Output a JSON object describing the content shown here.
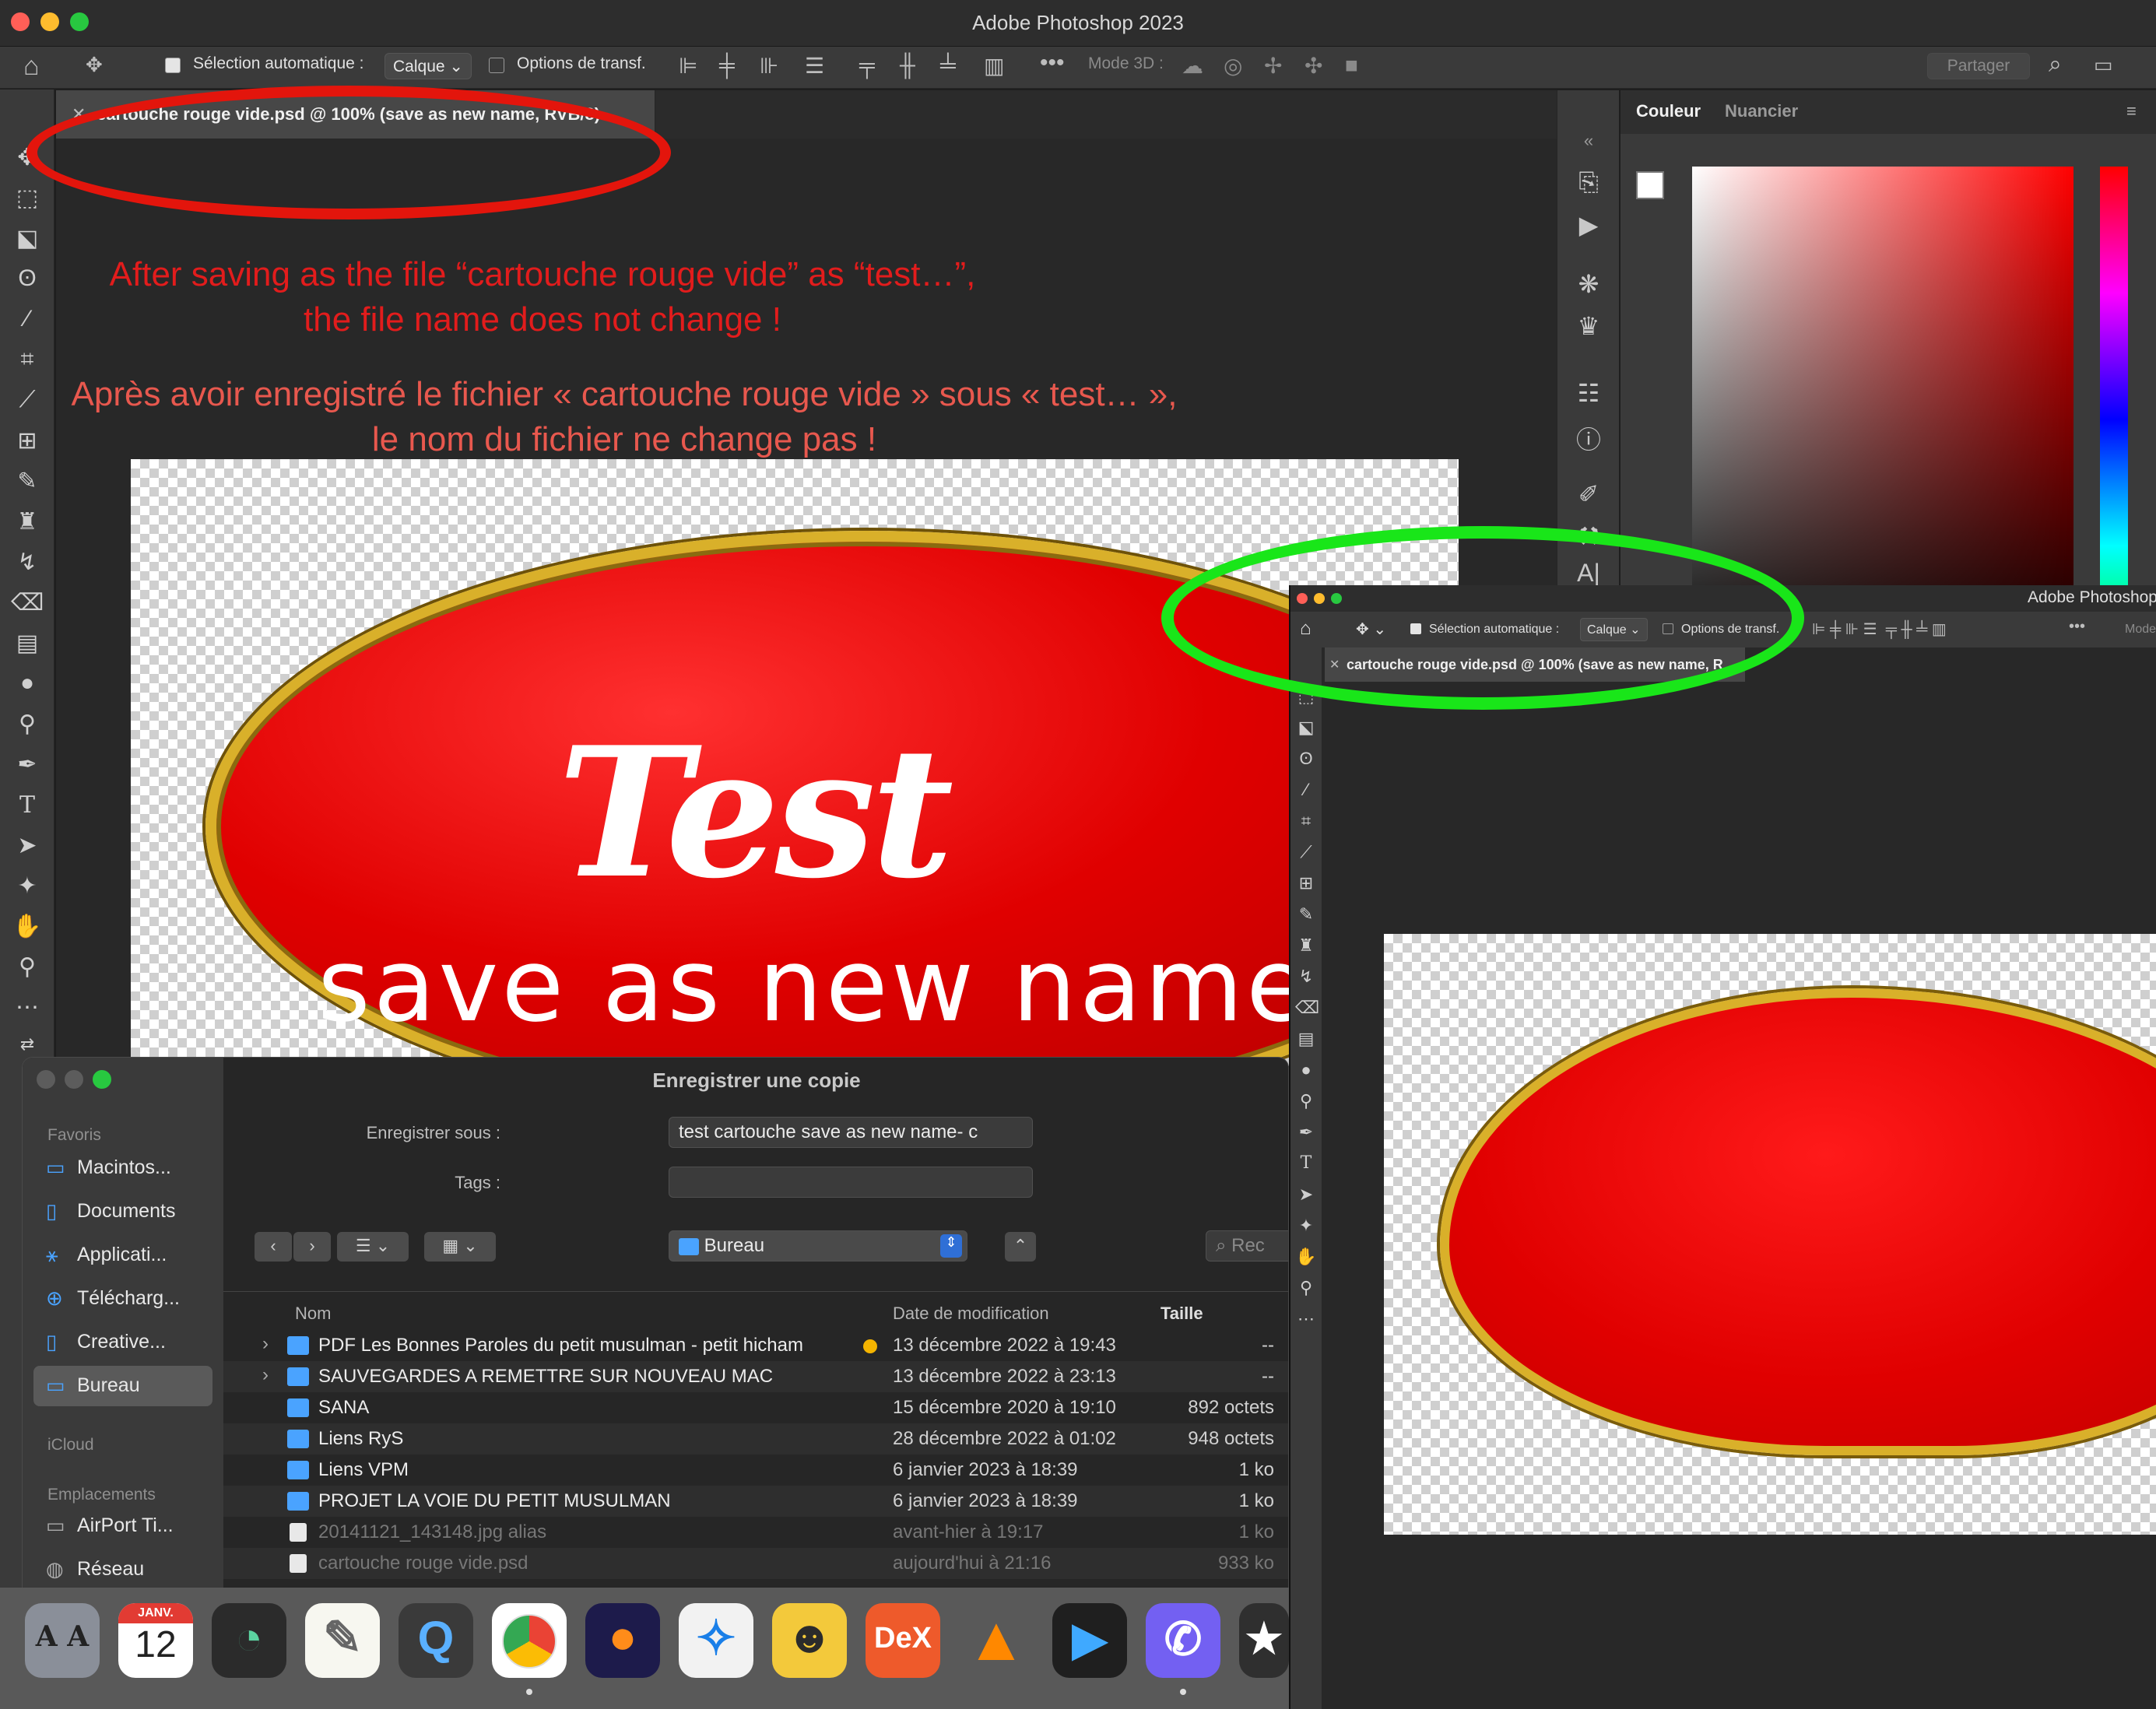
{
  "app": {
    "title": "Adobe Photoshop 2023",
    "document_tab": "cartouche rouge vide.psd @ 100% (save as new name, RVB/8)"
  },
  "options_bar": {
    "auto_select_label": "Sélection automatique :",
    "auto_select_value": "Calque",
    "transform_options": "Options de transf.",
    "mode3d": "Mode 3D :",
    "share_button": "Partager"
  },
  "annotations": {
    "en_line1": "After saving as the file “cartouche rouge vide” as “test…”,",
    "en_line2": "the file name does not change !",
    "fr_line1": "Après avoir enregistré le fichier « cartouche rouge vide » sous « test… »,",
    "fr_line2": "le nom du fichier ne change pas !"
  },
  "artwork": {
    "big_word": "Test",
    "subtitle": "save as new name"
  },
  "panels": {
    "tab_color": "Couleur",
    "tab_swatches": "Nuancier"
  },
  "window2": {
    "title": "Adobe Photoshop",
    "auto_select_label": "Sélection automatique :",
    "auto_select_value": "Calque",
    "transform_options": "Options de transf.",
    "mode": "Mode",
    "document_tab": "cartouche rouge vide.psd @ 100% (save as new name, R"
  },
  "dialog": {
    "title": "Enregistrer une copie",
    "save_as_label": "Enregistrer sous :",
    "save_as_value": "test cartouche save as new name- c",
    "tags_label": "Tags :",
    "location": "Bureau",
    "search_placeholder": "Rec",
    "sidebar": {
      "favorites_label": "Favoris",
      "favorites": [
        "Macintos...",
        "Documents",
        "Applicati...",
        "Télécharg...",
        "Creative...",
        "Bureau"
      ],
      "icloud_label": "iCloud",
      "locations_label": "Emplacements",
      "locations": [
        "AirPort Ti...",
        "Réseau"
      ]
    },
    "columns": {
      "name": "Nom",
      "date": "Date de modification",
      "size": "Taille"
    },
    "files": [
      {
        "name": "PDF Les Bonnes Paroles du petit musulman - petit hicham",
        "date": "13 décembre 2022 à 19:43",
        "size": "--",
        "folder": true,
        "expandable": true,
        "tag": true
      },
      {
        "name": "SAUVEGARDES A REMETTRE SUR NOUVEAU MAC",
        "date": "13 décembre 2022 à 23:13",
        "size": "--",
        "folder": true,
        "expandable": true
      },
      {
        "name": "SANA",
        "date": "15 décembre 2020 à 19:10",
        "size": "892 octets",
        "folder": true
      },
      {
        "name": "Liens RyS",
        "date": "28 décembre 2022 à 01:02",
        "size": "948 octets",
        "folder": true
      },
      {
        "name": "Liens VPM",
        "date": "6 janvier 2023 à 18:39",
        "size": "1 ko",
        "folder": true
      },
      {
        "name": "PROJET LA VOIE DU PETIT MUSULMAN",
        "date": "6 janvier 2023 à 18:39",
        "size": "1 ko",
        "folder": true
      },
      {
        "name": "20141121_143148.jpg alias",
        "date": "avant-hier à 19:17",
        "size": "1 ko",
        "folder": false,
        "dim": true
      },
      {
        "name": "cartouche rouge vide.psd",
        "date": "aujourd'hui à 21:16",
        "size": "933 ko",
        "folder": false,
        "dim": true
      }
    ]
  },
  "dock": {
    "calendar_month": "JANV.",
    "calendar_day": "12",
    "dex_label": "DeX",
    "dictionary_label": "A A"
  },
  "colors": {
    "annotation_red": "#e21c1c",
    "ellipse_red": "#e3150c",
    "ellipse_green": "#19e619",
    "cartouche_red": "#e00000",
    "gold_border": "#d9b02a"
  }
}
